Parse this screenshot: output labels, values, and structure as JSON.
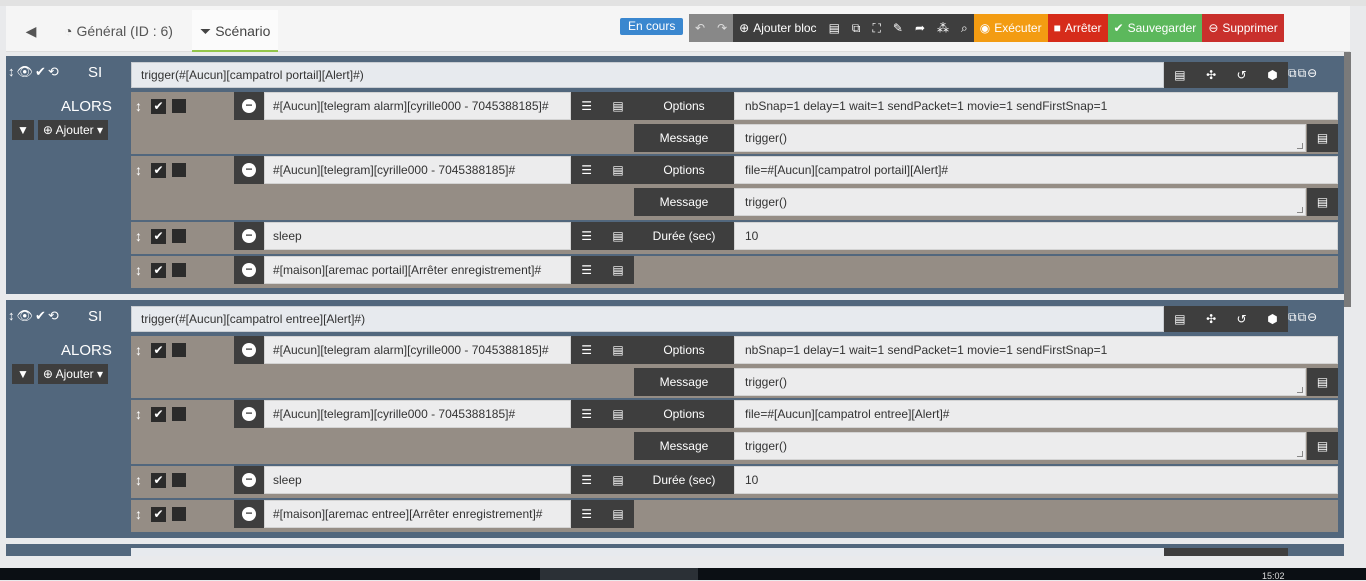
{
  "tabs": {
    "back_icon": "back-circle-icon",
    "general_label": "Général (ID : 6)",
    "scenario_label": "Scénario"
  },
  "status": {
    "label": "En cours",
    "color": "#3a87cf"
  },
  "toolbar": {
    "add_block": "Ajouter bloc",
    "execute": "Exécuter",
    "stop": "Arrêter",
    "save": "Sauvegarder",
    "delete": "Supprimer"
  },
  "labels": {
    "si": "SI",
    "alors": "ALORS",
    "ajouter": "Ajouter",
    "options": "Options",
    "message": "Message",
    "duree": "Durée (sec)"
  },
  "blocks": [
    {
      "condition": "trigger(#[Aucun][campatrol portail][Alert]#)",
      "actions": [
        {
          "cmd": "#[Aucun][telegram alarm][cyrille000 - 7045388185]#",
          "options": "nbSnap=1 delay=1 wait=1 sendPacket=1 movie=1 sendFirstSnap=1",
          "message": "trigger()"
        },
        {
          "cmd": "#[Aucun][telegram][cyrille000 - 7045388185]#",
          "options": "file=#[Aucun][campatrol portail][Alert]#",
          "message": "trigger()"
        },
        {
          "cmd": "sleep",
          "duree": "10"
        },
        {
          "cmd": "#[maison][aremac portail][Arrêter enregistrement]#"
        }
      ]
    },
    {
      "condition": "trigger(#[Aucun][campatrol entree][Alert]#)",
      "actions": [
        {
          "cmd": "#[Aucun][telegram alarm][cyrille000 - 7045388185]#",
          "options": "nbSnap=1 delay=1 wait=1 sendPacket=1 movie=1 sendFirstSnap=1",
          "message": "trigger()"
        },
        {
          "cmd": "#[Aucun][telegram][cyrille000 - 7045388185]#",
          "options": "file=#[Aucun][campatrol entree][Alert]#",
          "message": "trigger()"
        },
        {
          "cmd": "sleep",
          "duree": "10"
        },
        {
          "cmd": "#[maison][aremac entree][Arrêter enregistrement]#"
        }
      ]
    }
  ],
  "clock": "15:02"
}
